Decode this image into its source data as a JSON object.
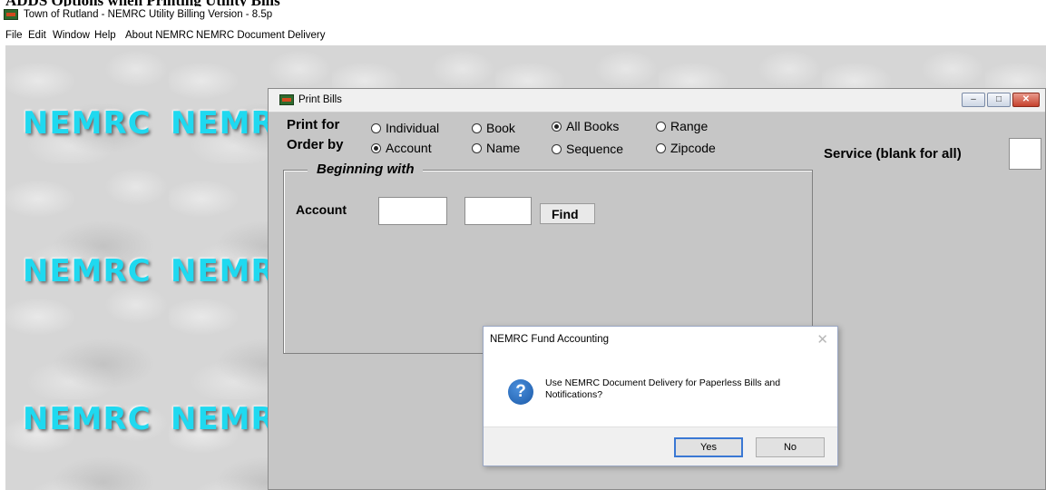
{
  "document": {
    "heading": "ADDS Options when Printing Utility Bills"
  },
  "app": {
    "title": "Town of Rutland - NEMRC Utility Billing Version - 8.5p",
    "menu": [
      "File",
      "Edit",
      "Window",
      "Help",
      "About NEMRC",
      "NEMRC Document Delivery"
    ]
  },
  "desktop": {
    "logo_text": "NEMRC"
  },
  "print_bills": {
    "title": "Print Bills",
    "print_for_label": "Print for",
    "print_for_options": [
      {
        "label": "Individual",
        "selected": false
      },
      {
        "label": "Book",
        "selected": false
      },
      {
        "label": "All Books",
        "selected": true
      },
      {
        "label": "Range",
        "selected": false
      }
    ],
    "order_by_label": "Order by",
    "order_by_options": [
      {
        "label": "Account",
        "selected": true
      },
      {
        "label": "Name",
        "selected": false
      },
      {
        "label": "Sequence",
        "selected": false
      },
      {
        "label": "Zipcode",
        "selected": false
      }
    ],
    "beginning_with_label": "Beginning with",
    "account_label": "Account",
    "account_value_1": "",
    "account_value_2": "",
    "find_label": "Find",
    "service_label": "Service (blank for all)",
    "service_value": ""
  },
  "dialog": {
    "title": "NEMRC Fund Accounting",
    "message": "Use NEMRC Document Delivery for Paperless Bills and Notifications?",
    "yes_label": "Yes",
    "no_label": "No"
  }
}
